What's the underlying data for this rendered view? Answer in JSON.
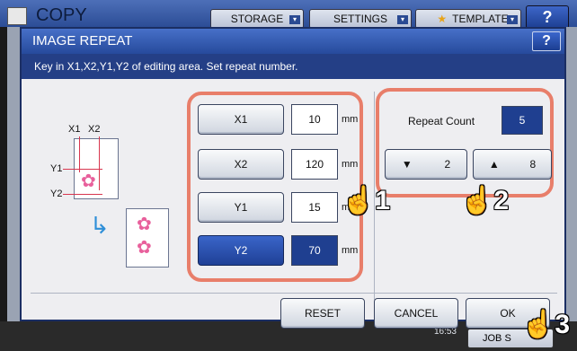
{
  "app": {
    "title": "COPY",
    "tabs": [
      "STORAGE",
      "SETTINGS",
      "TEMPLATE"
    ],
    "help": "?"
  },
  "dialog": {
    "title": "IMAGE REPEAT",
    "help": "?",
    "instruction": "Key in X1,X2,Y1,Y2 of editing area. Set repeat number."
  },
  "illustration": {
    "x1": "X1",
    "x2": "X2",
    "y1": "Y1",
    "y2": "Y2"
  },
  "edit_area": [
    {
      "label": "X1",
      "value": "10",
      "unit": "mm",
      "selected": false
    },
    {
      "label": "X2",
      "value": "120",
      "unit": "mm",
      "selected": false
    },
    {
      "label": "Y1",
      "value": "15",
      "unit": "mm",
      "selected": false
    },
    {
      "label": "Y2",
      "value": "70",
      "unit": "mm",
      "selected": true
    }
  ],
  "repeat": {
    "label": "Repeat Count",
    "value": "5",
    "down_value": "2",
    "up_value": "8"
  },
  "footer": {
    "reset": "RESET",
    "cancel": "CANCEL",
    "ok": "OK"
  },
  "status": {
    "time": "16:53",
    "job": "JOB S"
  },
  "callouts": [
    "1",
    "2",
    "3"
  ],
  "colors": {
    "accent": "#264a9c",
    "highlight": "#e87e6a",
    "selected": "#1f3f90",
    "flower": "#e8609c"
  }
}
